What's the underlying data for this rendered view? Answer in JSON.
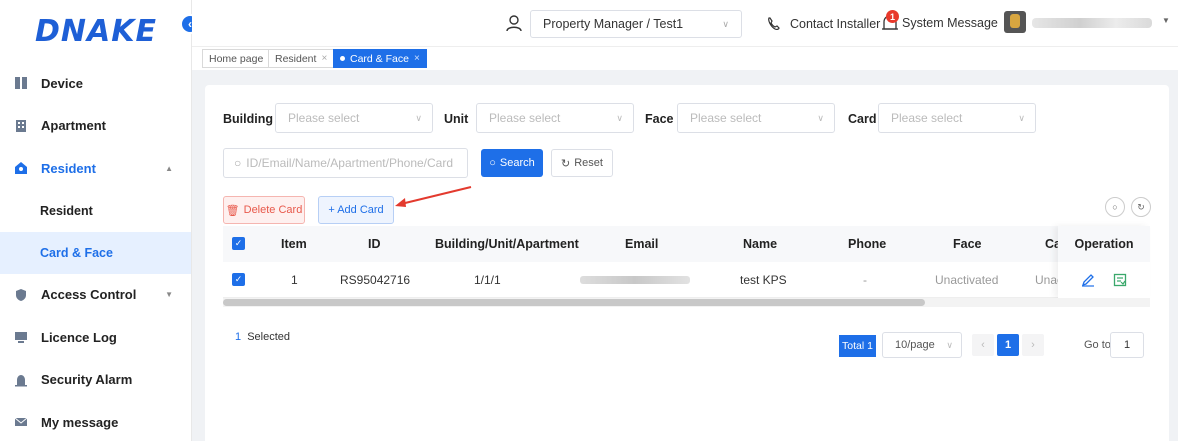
{
  "brand": {
    "logo_text": "DNAKE",
    "collapse_glyph": "‹"
  },
  "header": {
    "role": "Property Manager / Test1",
    "contact_label": "Contact Installer",
    "system_message_label": "System Message",
    "system_message_count": "1"
  },
  "sidebar": {
    "items": [
      {
        "label": "Device",
        "icon": "device-icon"
      },
      {
        "label": "Apartment",
        "icon": "apartment-icon"
      },
      {
        "label": "Resident",
        "icon": "resident-icon"
      },
      {
        "label": "Access Control",
        "icon": "shield-icon"
      },
      {
        "label": "Licence Log",
        "icon": "licence-icon"
      },
      {
        "label": "Security Alarm",
        "icon": "alarm-icon"
      },
      {
        "label": "My message",
        "icon": "message-icon"
      }
    ],
    "sub_items": [
      {
        "label": "Resident"
      },
      {
        "label": "Card & Face"
      }
    ]
  },
  "tabs": [
    {
      "label": "Home page"
    },
    {
      "label": "Resident",
      "close": "×"
    },
    {
      "label": "Card & Face",
      "close": "×"
    }
  ],
  "filters": {
    "building_label": "Building",
    "unit_label": "Unit",
    "face_label": "Face",
    "card_label": "Card",
    "placeholder": "Please select",
    "search_placeholder": "ID/Email/Name/Apartment/Phone/Card",
    "search_button": "Search",
    "reset_button": "Reset"
  },
  "actions": {
    "delete_card": "Delete Card",
    "add_card": "+ Add Card"
  },
  "table": {
    "columns": {
      "item": "Item",
      "id": "ID",
      "building": "Building/Unit/Apartment",
      "email": "Email",
      "name": "Name",
      "phone": "Phone",
      "face": "Face",
      "card": "Ca",
      "operation": "Operation"
    },
    "row": {
      "item": "1",
      "id": "RS95042716",
      "building": "1/1/1",
      "name": "test KPS",
      "phone": "-",
      "face": "Unactivated",
      "card": "Unacti"
    }
  },
  "footer": {
    "selected_count": "1",
    "selected_label": "Selected",
    "total": "Total 1",
    "page_size": "10/page",
    "current_page": "1",
    "goto_label": "Go to",
    "goto_value": "1"
  },
  "colors": {
    "accent": "#1e6fe8",
    "danger": "#e8594b",
    "brand_red": "#e8392b"
  }
}
